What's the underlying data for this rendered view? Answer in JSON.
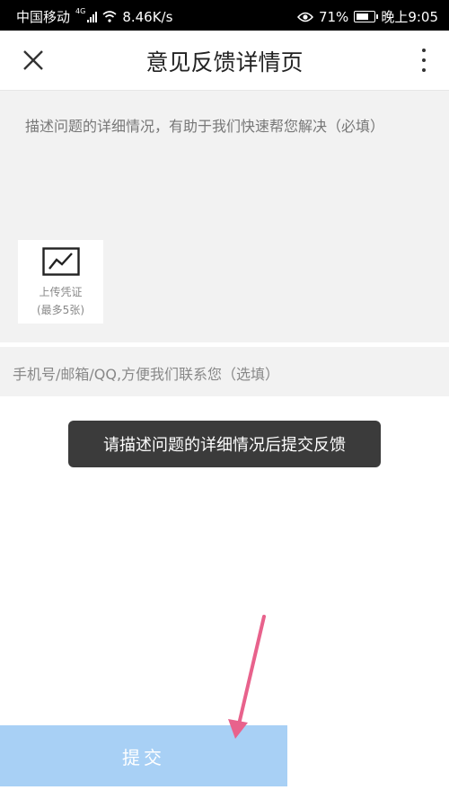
{
  "status_bar": {
    "carrier": "中国移动",
    "network_type": "4G",
    "speed": "8.46K/s",
    "battery": "71%",
    "time": "晚上9:05"
  },
  "header": {
    "title": "意见反馈详情页"
  },
  "description": {
    "placeholder": "描述问题的详细情况，有助于我们快速帮您解决（必填）"
  },
  "upload": {
    "label_line1": "上传凭证",
    "label_line2": "(最多5张)"
  },
  "contact": {
    "placeholder": "手机号/邮箱/QQ,方便我们联系您（选填）"
  },
  "toast": {
    "message": "请描述问题的详细情况后提交反馈"
  },
  "submit": {
    "label": "提交"
  },
  "colors": {
    "submit_bg": "#a8d0f5",
    "toast_bg": "#3b3b3b",
    "annotation_arrow": "#e8628c"
  }
}
